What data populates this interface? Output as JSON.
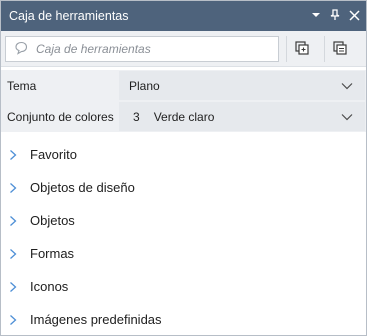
{
  "window": {
    "title": "Caja de herramientas",
    "controls": [
      "chevron-down-icon",
      "pin-icon",
      "close-icon"
    ]
  },
  "search": {
    "placeholder": "Caja de herramientas",
    "icon": "speech-bubble-icon"
  },
  "toolbar": {
    "buttons": [
      "new-window-icon",
      "stack-windows-icon"
    ]
  },
  "properties": {
    "theme_label": "Tema",
    "theme_value": "Plano",
    "colors_label": "Conjunto de colores",
    "colors_number": "3",
    "colors_value": "Verde claro"
  },
  "categories": [
    "Favorito",
    "Objetos de diseño",
    "Objetos",
    "Formas",
    "Iconos",
    "Imágenes predefinidas"
  ],
  "colors": {
    "titlebar": "#4e637c",
    "panel_bg": "#eef0f3",
    "chevron_accent": "#4e8fd6"
  }
}
